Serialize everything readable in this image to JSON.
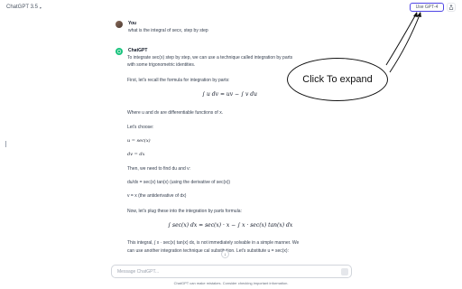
{
  "header": {
    "model": "ChatGPT 3.5",
    "upgrade_label": "Use GPT-4",
    "share_icon": "share-icon"
  },
  "user_message": {
    "author": "You",
    "text": "what is the integral of secx, step by step"
  },
  "assistant_message": {
    "author": "ChatGPT",
    "lines": {
      "intro1": "To integrate sec(x) step by step, we can use a technique called integration by parts",
      "intro2": "with some trigonometric identities.",
      "recall": "First, let's recall the formula for integration by parts:",
      "formula": "∫ u dv = uv − ∫ v du",
      "where": "Where u and dv are differentiable functions of x.",
      "choose": "Let's choose:",
      "u_eq": "u = sec(x)",
      "dv_eq": "dv = dx",
      "find": "Then, we need to find du and v:",
      "du_eq": "du/dx = sec(x) tan(x) (using the derivative of sec(x))",
      "v_eq": "v = x (the antiderivative of dx)",
      "plug": "Now, let's plug these into the integration by parts formula:",
      "applied": "∫ sec(x) dx = sec(x) · x − ∫ x · sec(x) tan(x) dx",
      "this1": "This integral, ∫ x · sec(x) tan(x) dx, is not immediately solvable in a simple manner. We",
      "this2": "can use another integration technique cal     substitution. Let's substitute u = sec(x):"
    }
  },
  "annotation": {
    "callout_text": "Click To expand"
  },
  "composer": {
    "placeholder": "Message ChatGPT...",
    "disclaimer": "ChatGPT can make mistakes. Consider checking important information."
  }
}
